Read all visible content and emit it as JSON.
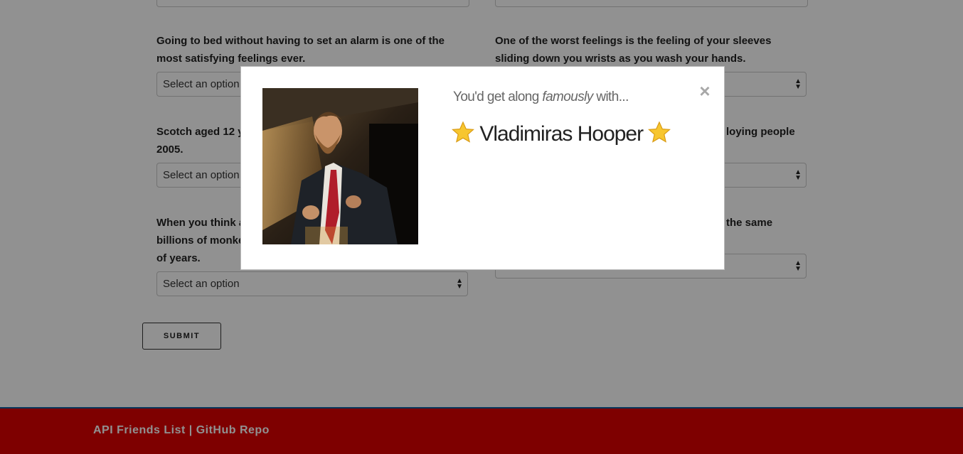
{
  "form": {
    "questions": [
      {
        "text": "Going to bed without having to set an alarm is one of the most satisfying feelings ever.",
        "value": "Select an option"
      },
      {
        "text": "One of the worst feelings is the feeling of your sleeves sliding down you wrists as you wash your hands.",
        "value": ""
      },
      {
        "text": "Scotch aged 12 y",
        "text_tail": "2005.",
        "value": "Select an option"
      },
      {
        "text": "loying people",
        "value": ""
      },
      {
        "text": "When you think a",
        "text_l2": "billions of monke",
        "text_l3": "of years.",
        "value": "Select an option"
      },
      {
        "text": "the same",
        "value": ""
      }
    ],
    "submit_label": "SUBMIT"
  },
  "footer": {
    "link1": "API Friends List",
    "separator": "|",
    "link2": "GitHub Repo"
  },
  "modal": {
    "subtitle_pre": "You'd get along ",
    "subtitle_em": "famously",
    "subtitle_post": " with...",
    "name": "Vladimiras Hooper",
    "close_glyph": "×",
    "star_icon": "star-icon"
  },
  "colors": {
    "footer_bg": "#dd0000",
    "footer_border": "#0f5fa0",
    "overlay": "rgba(0,0,0,0.43)",
    "star": "#f7c62f"
  }
}
